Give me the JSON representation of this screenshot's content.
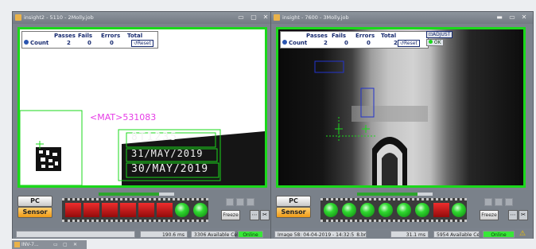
{
  "window1": {
    "title": "insight2 - 5110 - 2Molly.job",
    "counts": {
      "header_passes": "Passes",
      "header_fails": "Fails",
      "header_errors": "Errors",
      "header_total": "Total",
      "label": "Count",
      "passes": "2",
      "fails": "0",
      "errors": "0",
      "total": "2",
      "reset_label": "Reset"
    },
    "image_text": {
      "mat_readout": "<MAT>531083",
      "lot_line": "8T1235",
      "date_line1": "31/MAY/2019",
      "date_line2": "30/MAY/2019"
    },
    "pc_label": "PC",
    "sensor_label": "Sensor",
    "freeze_label": "Freeze",
    "status": {
      "time": "190.6 ms",
      "cells": "3306 Available Cells",
      "state": "Online"
    },
    "filmstrip": [
      "red",
      "red",
      "red",
      "red",
      "red",
      "red",
      "green",
      "green"
    ],
    "progress_fraction": 0.8
  },
  "window2": {
    "title": "insight - 7600 - 3Molly.job",
    "counts": {
      "header_passes": "Passes",
      "header_fails": "Fails",
      "header_errors": "Errors",
      "header_total": "Total",
      "label": "Count",
      "passes": "2",
      "fails": "0",
      "errors": "0",
      "total": "2",
      "reset_label": "Reset",
      "adjust_label": "ADJUST",
      "ok_label": "OK"
    },
    "pc_label": "PC",
    "sensor_label": "Sensor",
    "freeze_label": "Freeze",
    "status": {
      "image_info": "Image 58: 04-04-2019 - 14:32:5_8.bmp",
      "time": "31.1 ms",
      "cells": "5954 Available Cells",
      "state": "Online"
    },
    "filmstrip": [
      "green",
      "green",
      "green",
      "green",
      "green",
      "green",
      "red",
      "green"
    ],
    "progress_fraction": 0.8
  },
  "taskbar": {
    "label": "INV-7..."
  },
  "colors": {
    "pass_green": "#1bd81b",
    "fail_red": "#d91c1c",
    "count_text": "#172a6f",
    "mat_magenta": "#e63ce6",
    "sensor_orange": "#f2a31d"
  }
}
